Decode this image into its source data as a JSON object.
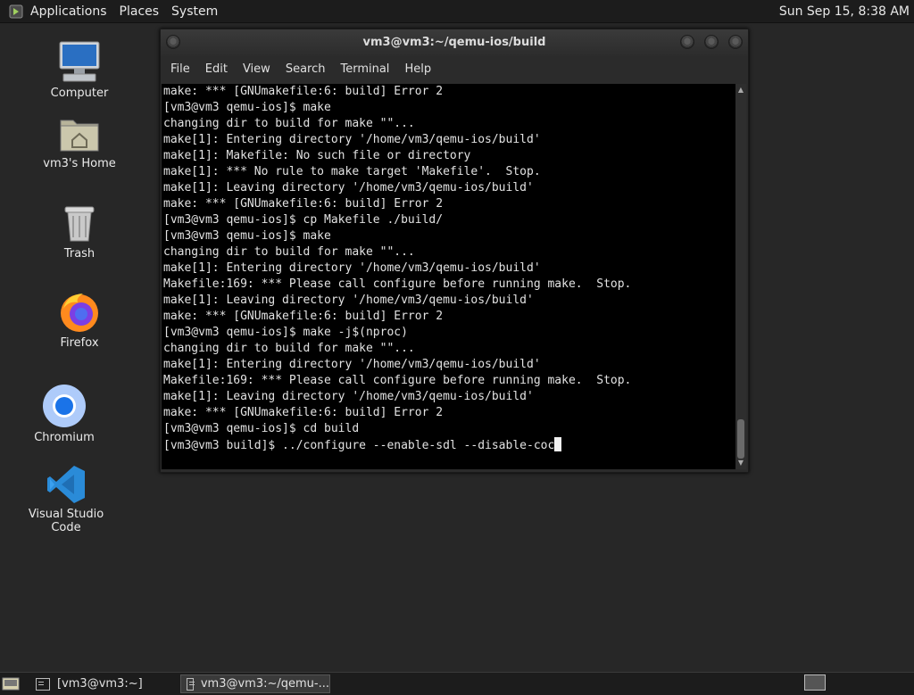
{
  "top_panel": {
    "menus": [
      "Applications",
      "Places",
      "System"
    ],
    "clock": "Sun Sep 15,  8:38 AM"
  },
  "desktop_icons": [
    {
      "label": "Computer",
      "icon": "computer-icon"
    },
    {
      "label": "vm3's Home",
      "icon": "home-folder-icon"
    },
    {
      "label": "Trash",
      "icon": "trash-icon"
    },
    {
      "label": "Firefox",
      "icon": "firefox-icon"
    },
    {
      "label": "Chromium",
      "icon": "chromium-icon"
    },
    {
      "label": "Visual Studio Code",
      "icon": "vscode-icon"
    }
  ],
  "terminal": {
    "title": "vm3@vm3:~/qemu-ios/build",
    "menu": [
      "File",
      "Edit",
      "View",
      "Search",
      "Terminal",
      "Help"
    ],
    "lines": [
      "make: *** [GNUmakefile:6: build] Error 2",
      "[vm3@vm3 qemu-ios]$ make",
      "changing dir to build for make \"\"...",
      "make[1]: Entering directory '/home/vm3/qemu-ios/build'",
      "make[1]: Makefile: No such file or directory",
      "make[1]: *** No rule to make target 'Makefile'.  Stop.",
      "make[1]: Leaving directory '/home/vm3/qemu-ios/build'",
      "make: *** [GNUmakefile:6: build] Error 2",
      "[vm3@vm3 qemu-ios]$ cp Makefile ./build/",
      "[vm3@vm3 qemu-ios]$ make",
      "changing dir to build for make \"\"...",
      "make[1]: Entering directory '/home/vm3/qemu-ios/build'",
      "Makefile:169: *** Please call configure before running make.  Stop.",
      "make[1]: Leaving directory '/home/vm3/qemu-ios/build'",
      "make: *** [GNUmakefile:6: build] Error 2",
      "[vm3@vm3 qemu-ios]$ make -j$(nproc)",
      "changing dir to build for make \"\"...",
      "make[1]: Entering directory '/home/vm3/qemu-ios/build'",
      "Makefile:169: *** Please call configure before running make.  Stop.",
      "make[1]: Leaving directory '/home/vm3/qemu-ios/build'",
      "make: *** [GNUmakefile:6: build] Error 2",
      "[vm3@vm3 qemu-ios]$ cd build"
    ],
    "current_input": "[vm3@vm3 build]$ ../configure --enable-sdl --disable-coc"
  },
  "taskbar": {
    "tasks": [
      "[vm3@vm3:~]",
      "vm3@vm3:~/qemu-..."
    ]
  }
}
